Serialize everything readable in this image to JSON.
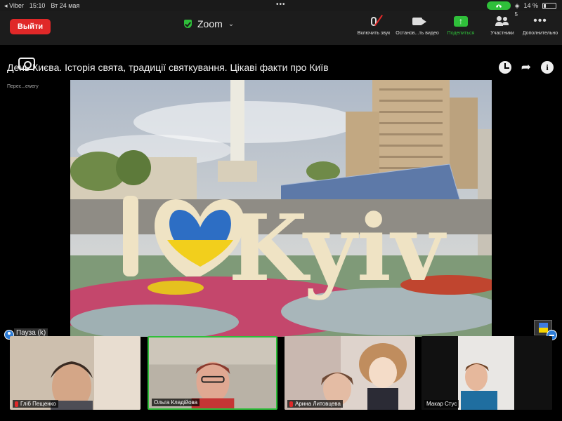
{
  "status_bar": {
    "app": "◂ Viber",
    "time": "15:10",
    "date": "Вт 24 мая",
    "dots": "•••",
    "battery_text": "14 %"
  },
  "toolbar": {
    "leave_label": "Выйти",
    "meeting_label": "Zoom",
    "items": [
      {
        "label": "Включить звук"
      },
      {
        "label": "Останов...ть видео"
      },
      {
        "label": "Поделиться"
      },
      {
        "label": "Участники",
        "count": "5"
      },
      {
        "label": "Дополнительно"
      }
    ]
  },
  "share": {
    "title": "День Києва. Історія свята, традиції святкування. Цікаві факти про Київ",
    "note": "Перес...ewery",
    "sign_text": "Kyiv",
    "sign_prefix": "I"
  },
  "pause_label": "Пауза (k)",
  "participants": [
    {
      "name": "Гліб Пещенко",
      "muted": true,
      "active": false
    },
    {
      "name": "Ольга Кладійова",
      "muted": false,
      "active": true
    },
    {
      "name": "Арина Литовцева",
      "muted": true,
      "active": false
    },
    {
      "name": "Макар Стус",
      "muted": false,
      "active": false
    }
  ],
  "colors": {
    "leave": "#e02828",
    "accent_green": "#2fbf3a",
    "flag_blue": "#3d7ae0",
    "flag_yellow": "#f5d400"
  }
}
